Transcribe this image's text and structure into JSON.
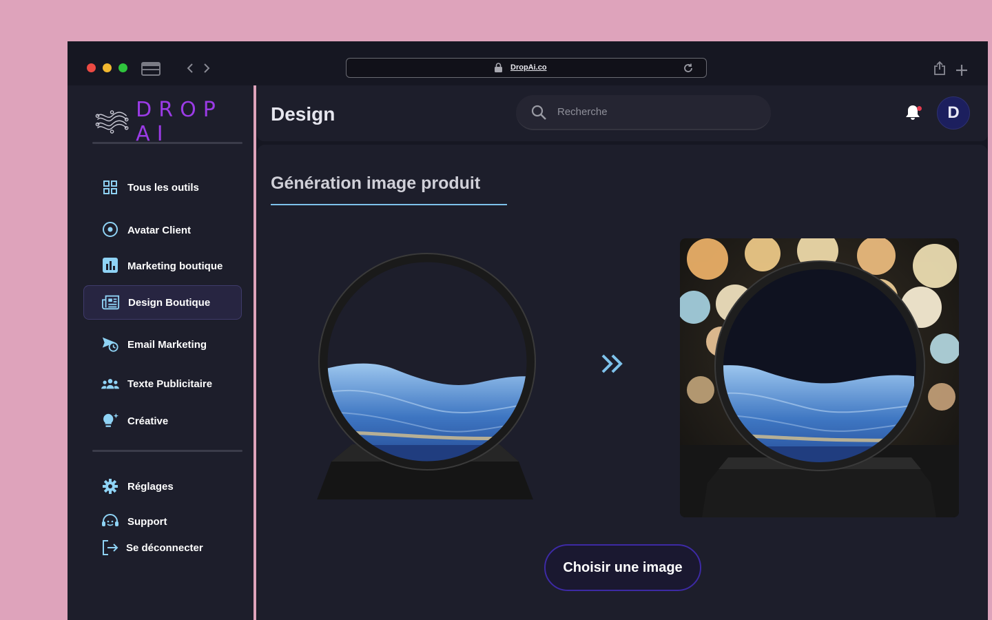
{
  "browser": {
    "url": "DropAi.co"
  },
  "brand": {
    "logo_text": "DROP AI",
    "accent_color": "#9b3be6"
  },
  "sidebar": {
    "items": [
      {
        "label": "Tous les outils",
        "icon": "grid-icon"
      },
      {
        "label": "Avatar Client",
        "icon": "target-icon"
      },
      {
        "label": "Marketing boutique",
        "icon": "bar-chart-icon"
      },
      {
        "label": "Design Boutique",
        "icon": "newspaper-icon",
        "active": true
      },
      {
        "label": "Email Marketing",
        "icon": "send-clock-icon"
      },
      {
        "label": "Texte Publicitaire",
        "icon": "people-icon"
      },
      {
        "label": "Créative",
        "icon": "lightbulb-icon"
      }
    ],
    "footer_items": [
      {
        "label": "Réglages",
        "icon": "gear-icon"
      },
      {
        "label": "Support",
        "icon": "headset-icon"
      },
      {
        "label": "Se déconnecter",
        "icon": "logout-icon"
      }
    ]
  },
  "header": {
    "title": "Design",
    "search_placeholder": "Recherche",
    "avatar_initial": "D",
    "notification_badge_color": "#e43b4f"
  },
  "main": {
    "section_title": "Génération image produit",
    "choose_button_label": "Choisir une image",
    "underline_color": "#7ec2eb",
    "arrow_color": "#7ec2eb"
  }
}
